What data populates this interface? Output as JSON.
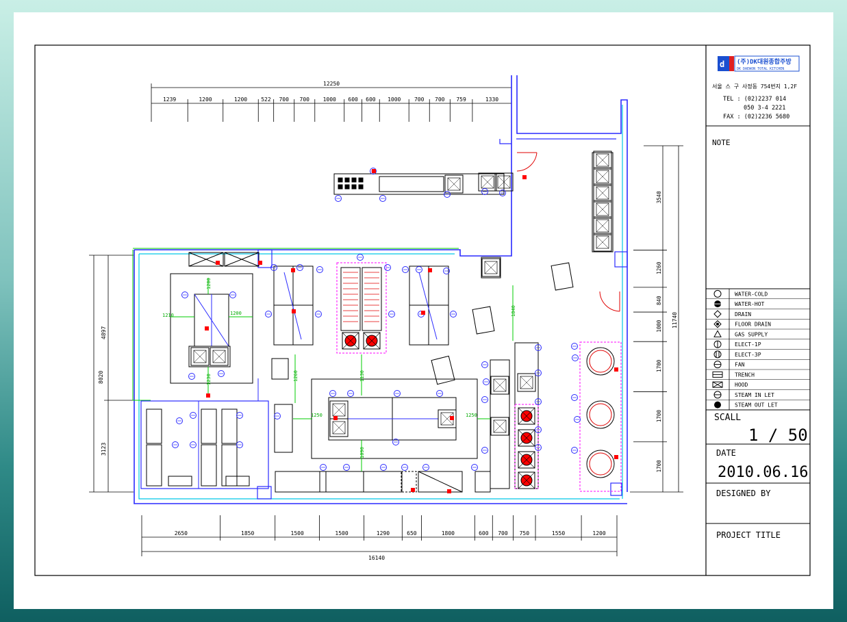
{
  "title_block": {
    "company_name": "(주)DK대원종합주방",
    "company_sub": "DK DAEWON TOTAL KITCHEN",
    "address": "서울 스 구 사정동 754번지 1,2F",
    "tel_1": "TEL : (02)2237 014",
    "tel_2": "050 3-4 2221",
    "fax": "FAX : (02)2236 5680",
    "note_label": "NOTE",
    "legend": [
      {
        "icon": "water-cold-icon",
        "label": "WATER-COLD"
      },
      {
        "icon": "water-hot-icon",
        "label": "WATER-HOT"
      },
      {
        "icon": "drain-icon",
        "label": "DRAIN"
      },
      {
        "icon": "floor-drain-icon",
        "label": "FLOOR DRAIN"
      },
      {
        "icon": "gas-supply-icon",
        "label": "GAS SUPPLY"
      },
      {
        "icon": "elect-1p-icon",
        "label": "ELECT-1P"
      },
      {
        "icon": "elect-3p-icon",
        "label": "ELECT-3P"
      },
      {
        "icon": "fan-icon",
        "label": "FAN"
      },
      {
        "icon": "trench-icon",
        "label": "TRENCH"
      },
      {
        "icon": "hood-icon",
        "label": "HOOD"
      },
      {
        "icon": "steam-inlet-icon",
        "label": "STEAM IN LET"
      },
      {
        "icon": "steam-outlet-icon",
        "label": "STEAM OUT LET"
      }
    ],
    "scale_label": "SCALL",
    "scale_value": "1 / 50",
    "date_label": "DATE",
    "date_value": "2010.06.16",
    "designed_label": "DESIGNED BY",
    "project_label": "PROJECT TITLE"
  },
  "dimensions": {
    "top_total": "12250",
    "top_segments": [
      "1239",
      "1200",
      "1200",
      "522",
      "700",
      "700",
      "1000",
      "600",
      "600",
      "1000",
      "700",
      "700",
      "759",
      "1330"
    ],
    "bottom_total": "16140",
    "bottom_segments": [
      "2650",
      "1850",
      "1500",
      "1500",
      "1290",
      "650",
      "1800",
      "600",
      "700",
      "750",
      "1550",
      "1200"
    ],
    "left_total": "8020",
    "left_segments": [
      "4897",
      "3123"
    ],
    "right_total": "11740",
    "right_segments": [
      "3540",
      "1260",
      "840",
      "1000",
      "1700",
      "1700",
      "1700"
    ],
    "interior": [
      "1200",
      "1210",
      "1200",
      "1230",
      "1260",
      "1840",
      "1130",
      "1250",
      "1250",
      "1090"
    ]
  },
  "colors": {
    "wall": "#2a2aff",
    "wall_inner": "#00c8e6",
    "magenta": "#ff00ff",
    "green": "#00cc00",
    "red": "#ff0000",
    "equipment": "#000000"
  }
}
